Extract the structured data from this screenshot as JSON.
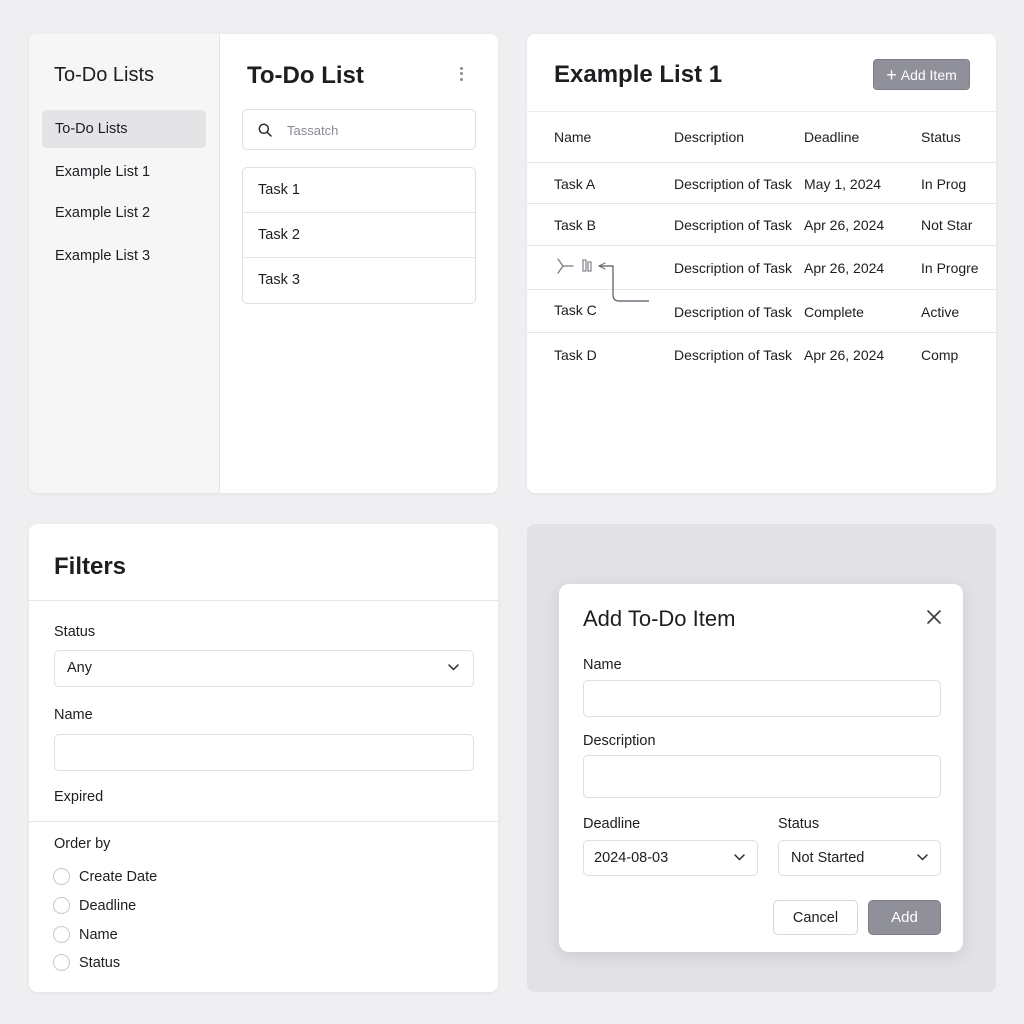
{
  "lists_panel": {
    "sidebar_title": "To-Do Lists",
    "sidebar_items": [
      {
        "label": "To-Do Lists",
        "active": true
      },
      {
        "label": "Example List 1",
        "active": false
      },
      {
        "label": "Example List 2",
        "active": false
      },
      {
        "label": "Example List 3",
        "active": false
      }
    ],
    "main_title": "To-Do List",
    "search_placeholder": "Tassatch",
    "tasks": [
      "Task 1",
      "Task 2",
      "Task 3"
    ]
  },
  "table_panel": {
    "title": "Example List 1",
    "add_button_label": "Add Item",
    "columns": [
      "Name",
      "Description",
      "Deadline",
      "Status"
    ],
    "rows": [
      {
        "name": "Task A",
        "description": "Description of Task",
        "deadline": "May 1, 2024",
        "status": "In Prog"
      },
      {
        "name": "Task B",
        "description": "Description of Task",
        "deadline": "Apr 26, 2024",
        "status": "Not Star"
      },
      {
        "name": "",
        "description": "Description of Task",
        "deadline": "Apr 26, 2024",
        "status": "In Progre"
      },
      {
        "name": "Task C",
        "description": "Description of Task",
        "deadline": "Complete",
        "status": "Active"
      },
      {
        "name": "Task D",
        "description": "Description of Task",
        "deadline": "Apr 26, 2024",
        "status": "Comp"
      }
    ]
  },
  "filters_panel": {
    "title": "Filters",
    "status_label": "Status",
    "status_value": "Any",
    "name_label": "Name",
    "name_value": "",
    "expired_label": "Expired",
    "order_label": "Order by",
    "order_options": [
      "Create Date",
      "Deadline",
      "Name",
      "Status"
    ]
  },
  "modal": {
    "title": "Add To-Do Item",
    "name_label": "Name",
    "name_value": "",
    "description_label": "Description",
    "description_value": "",
    "deadline_label": "Deadline",
    "deadline_value": "2024-08-03",
    "status_label": "Status",
    "status_value": "Not Started",
    "cancel_label": "Cancel",
    "add_label": "Add"
  },
  "colors": {
    "background": "#efeff1",
    "primary_button": "#8f9099",
    "active_item": "#e4e4e7",
    "text": "#1d1d22"
  }
}
